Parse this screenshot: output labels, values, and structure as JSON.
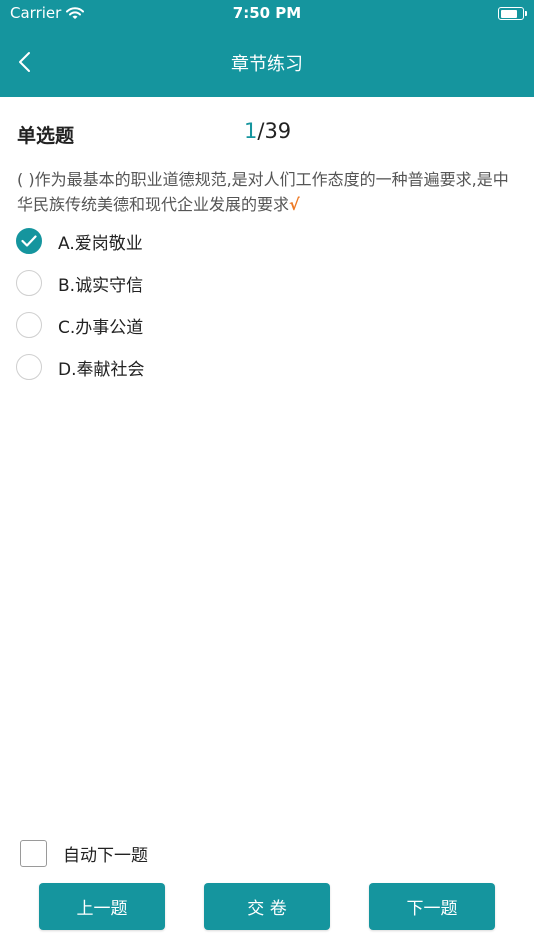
{
  "status_bar": {
    "carrier": "Carrier",
    "time": "7:50 PM",
    "battery_level": 0.9
  },
  "nav": {
    "title": "章节练习"
  },
  "question": {
    "type": "单选题",
    "current": "1",
    "total": "/39",
    "text": "( )作为最基本的职业道德规范,是对人们工作态度的一种普遍要求,是中华民族传统美德和现代企业发展的要求",
    "mark": "√",
    "options": [
      {
        "label": "A.爱岗敬业",
        "selected": true
      },
      {
        "label": "B.诚实守信",
        "selected": false
      },
      {
        "label": "C.办事公道",
        "selected": false
      },
      {
        "label": "D.奉献社会",
        "selected": false
      }
    ]
  },
  "auto_next": {
    "label": "自动下一题",
    "checked": false
  },
  "buttons": {
    "prev": "上一题",
    "submit": "交 卷",
    "next": "下一题"
  },
  "colors": {
    "accent": "#15959e",
    "mark": "#ee7a24"
  }
}
